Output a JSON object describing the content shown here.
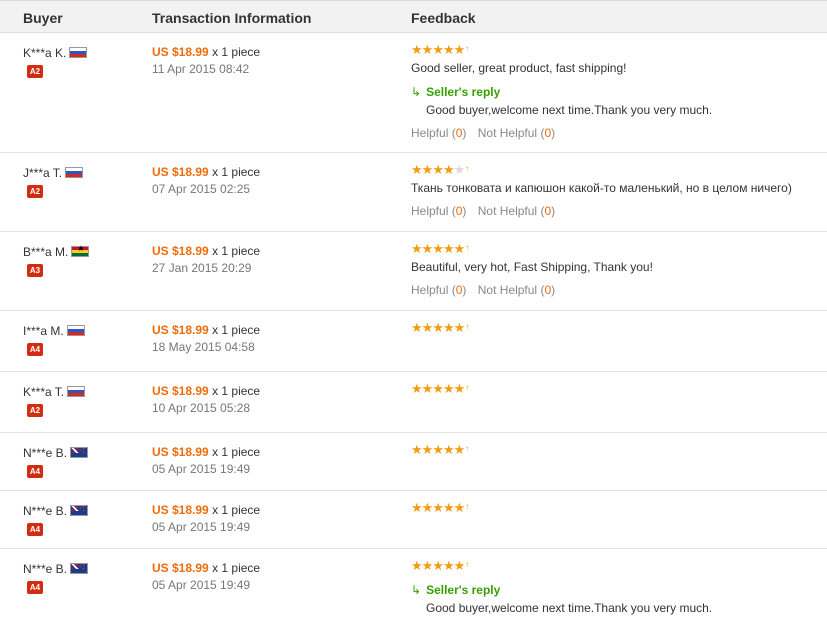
{
  "header": {
    "buyer": "Buyer",
    "transaction": "Transaction Information",
    "feedback": "Feedback"
  },
  "rows": [
    {
      "buyer": "K***a K.",
      "flag": "ru-flag-icon",
      "level": "A2",
      "price": "US $18.99",
      "qty": "x 1 piece",
      "date": "11 Apr 2015 08:42",
      "stars": 5,
      "comment": "Good seller, great product, fast shipping!",
      "reply_label": "Seller's reply",
      "reply": "Good buyer,welcome next time.Thank you very much.",
      "helpful_label": "Helpful",
      "helpful": "0",
      "not_helpful_label": "Not Helpful",
      "not_helpful": "0"
    },
    {
      "buyer": "J***a T.",
      "flag": "ru-flag-icon",
      "level": "A2",
      "price": "US $18.99",
      "qty": "x 1 piece",
      "date": "07 Apr 2015 02:25",
      "stars": 4,
      "comment": "Ткань тонковата и капюшон какой-то маленький, но в целом ничего)",
      "helpful_label": "Helpful",
      "helpful": "0",
      "not_helpful_label": "Not Helpful",
      "not_helpful": "0"
    },
    {
      "buyer": "B***a M.",
      "flag": "gh-flag-icon",
      "level": "A3",
      "price": "US $18.99",
      "qty": "x 1 piece",
      "date": "27 Jan 2015 20:29",
      "stars": 5,
      "comment": "Beautiful, very hot, Fast Shipping, Thank you!",
      "helpful_label": "Helpful",
      "helpful": "0",
      "not_helpful_label": "Not Helpful",
      "not_helpful": "0"
    },
    {
      "buyer": "I***a M.",
      "flag": "ru-flag-icon",
      "level": "A4",
      "price": "US $18.99",
      "qty": "x 1 piece",
      "date": "18 May 2015 04:58",
      "stars": 5
    },
    {
      "buyer": "K***a T.",
      "flag": "ru-flag-icon",
      "level": "A2",
      "price": "US $18.99",
      "qty": "x 1 piece",
      "date": "10 Apr 2015 05:28",
      "stars": 5
    },
    {
      "buyer": "N***e B.",
      "flag": "nz-flag-icon",
      "level": "A4",
      "price": "US $18.99",
      "qty": "x 1 piece",
      "date": "05 Apr 2015 19:49",
      "stars": 5
    },
    {
      "buyer": "N***e B.",
      "flag": "nz-flag-icon",
      "level": "A4",
      "price": "US $18.99",
      "qty": "x 1 piece",
      "date": "05 Apr 2015 19:49",
      "stars": 5
    },
    {
      "buyer": "N***e B.",
      "flag": "nz-flag-icon",
      "level": "A4",
      "price": "US $18.99",
      "qty": "x 1 piece",
      "date": "05 Apr 2015 19:49",
      "stars": 5,
      "reply_label": "Seller's reply",
      "reply": "Good buyer,welcome next time.Thank you very much."
    }
  ],
  "colors": {
    "price": "#f06b0a",
    "star": "#f39b12",
    "reply": "#35a100",
    "level_badge": "#d22d10"
  }
}
